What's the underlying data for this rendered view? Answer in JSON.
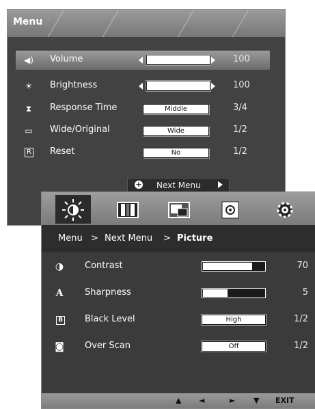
{
  "menu": {
    "title": "Menu",
    "items": [
      {
        "label": "Volume",
        "icon": "speaker-icon",
        "control": "slider",
        "level": 1.0,
        "value": "100",
        "selected": true
      },
      {
        "label": "Brightness",
        "icon": "sun-icon",
        "control": "slider",
        "level": 1.0,
        "value": "100",
        "selected": false
      },
      {
        "label": "Response Time",
        "icon": "hourglass-icon",
        "control": "box",
        "setting": "Middle",
        "value": "3/4",
        "selected": false
      },
      {
        "label": "Wide/Original",
        "icon": "aspect-ratio-icon",
        "control": "box",
        "setting": "Wide",
        "value": "1/2",
        "selected": false
      },
      {
        "label": "Reset",
        "icon": "reset-icon",
        "control": "box",
        "setting": "No",
        "value": "1/2",
        "selected": false
      }
    ],
    "next_label": "Next Menu"
  },
  "picture_menu": {
    "tabs": [
      "picture-tab-icon",
      "color-tab-icon",
      "display-tab-icon",
      "audio-tab-icon",
      "setup-tab-icon"
    ],
    "breadcrumb": {
      "root": "Menu",
      "sep1": ">",
      "middle": "Next Menu",
      "sep2": ">",
      "current": "Picture"
    },
    "items": [
      {
        "label": "Contrast",
        "icon": "contrast-icon",
        "glyph": "◑",
        "control": "bar",
        "level": 0.8,
        "value": "70"
      },
      {
        "label": "Sharpness",
        "icon": "sharpness-icon",
        "glyph": "A",
        "control": "bar",
        "level": 0.4,
        "value": "5"
      },
      {
        "label": "Black Level",
        "icon": "black-level-icon",
        "glyph": "B",
        "control": "box",
        "setting": "High",
        "value": "1/2"
      },
      {
        "label": "Over Scan",
        "icon": "overscan-icon",
        "glyph": "◙",
        "control": "box",
        "setting": "Off",
        "value": "1/2"
      }
    ],
    "footer": {
      "up": "▲",
      "left": "◄",
      "right": "►",
      "down": "▼",
      "exit": "EXIT"
    }
  }
}
